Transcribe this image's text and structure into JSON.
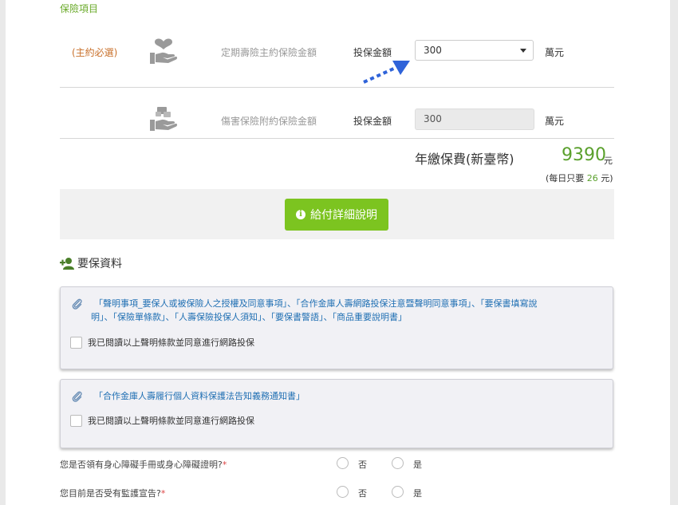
{
  "section_title": "保險項目",
  "rows": [
    {
      "tag": "(主約必選)",
      "icon": "heart-hand-icon",
      "name": "定期壽險主約保險金額",
      "amount_label": "投保金額",
      "amount_value": "300",
      "unit": "萬元"
    },
    {
      "icon": "injury-hand-icon",
      "name": "傷害保險附約保險金額",
      "amount_label": "投保金額",
      "amount_value": "300",
      "unit": "萬元"
    }
  ],
  "premium": {
    "label": "年繳保費(新臺幣)",
    "value": "9390",
    "unit": "元",
    "daily_prefix": "(每日只要 ",
    "daily_value": "26",
    "daily_suffix": " 元)"
  },
  "detail_button": "給付詳細說明",
  "application_title": "要保資料",
  "panels": [
    {
      "text_line1": "「聲明事項_要保人或被保險人之授權及同意事項」、「合作金庫人壽網路投保注意暨聲明同意事項」、「要保書填寫說",
      "text_line2": "明」、「保險單條款」、「人壽保險投保人須知」、「要保書警語」、「商品重要說明書」",
      "checkbox_label": "我已閱讀以上聲明條款並同意進行網路投保"
    },
    {
      "text_line1": "「合作金庫人壽履行個人資料保護法告知義務通知書」",
      "checkbox_label": "我已閱讀以上聲明條款並同意進行網路投保"
    }
  ],
  "questions": [
    {
      "label": "您是否領有身心障礙手冊或身心障礙證明?",
      "required": "*",
      "options": [
        "否",
        "是"
      ]
    },
    {
      "label": "您目前是否受有監護宣告?",
      "required": "*",
      "options": [
        "否",
        "是"
      ]
    }
  ],
  "colors": {
    "accent_green": "#7cc420",
    "required_orange": "#c9712c",
    "link_blue": "#1f6fb3",
    "arrow_blue": "#2f63d9"
  }
}
